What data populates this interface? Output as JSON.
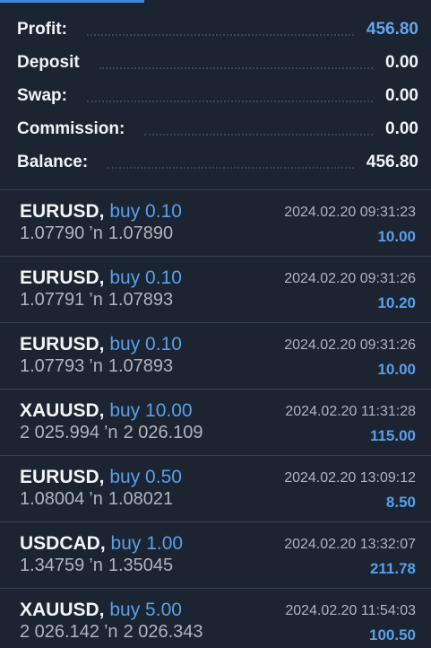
{
  "summary": {
    "profit": {
      "label": "Profit:",
      "value": "456.80"
    },
    "deposit": {
      "label": "Deposit",
      "value": "0.00"
    },
    "swap": {
      "label": "Swap:",
      "value": "0.00"
    },
    "commission": {
      "label": "Commission:",
      "value": "0.00"
    },
    "balance": {
      "label": "Balance:",
      "value": "456.80"
    }
  },
  "arrow_glyph": "’n",
  "trades": [
    {
      "symbol": "EURUSD,",
      "side": "buy 0.10",
      "open": "1.07790",
      "close": "1.07890",
      "time": "2024.02.20 09:31:23",
      "profit": "10.00"
    },
    {
      "symbol": "EURUSD,",
      "side": "buy 0.10",
      "open": "1.07791",
      "close": "1.07893",
      "time": "2024.02.20 09:31:26",
      "profit": "10.20"
    },
    {
      "symbol": "EURUSD,",
      "side": "buy 0.10",
      "open": "1.07793",
      "close": "1.07893",
      "time": "2024.02.20 09:31:26",
      "profit": "10.00"
    },
    {
      "symbol": "XAUUSD,",
      "side": "buy 10.00",
      "open": "2 025.994",
      "close": "2 026.109",
      "time": "2024.02.20 11:31:28",
      "profit": "115.00"
    },
    {
      "symbol": "EURUSD,",
      "side": "buy 0.50",
      "open": "1.08004",
      "close": "1.08021",
      "time": "2024.02.20 13:09:12",
      "profit": "8.50"
    },
    {
      "symbol": "USDCAD,",
      "side": "buy 1.00",
      "open": "1.34759",
      "close": "1.35045",
      "time": "2024.02.20 13:32:07",
      "profit": "211.78"
    },
    {
      "symbol": "XAUUSD,",
      "side": "buy 5.00",
      "open": "2 026.142",
      "close": "2 026.343",
      "time": "2024.02.20 11:54:03",
      "profit": "100.50"
    }
  ]
}
